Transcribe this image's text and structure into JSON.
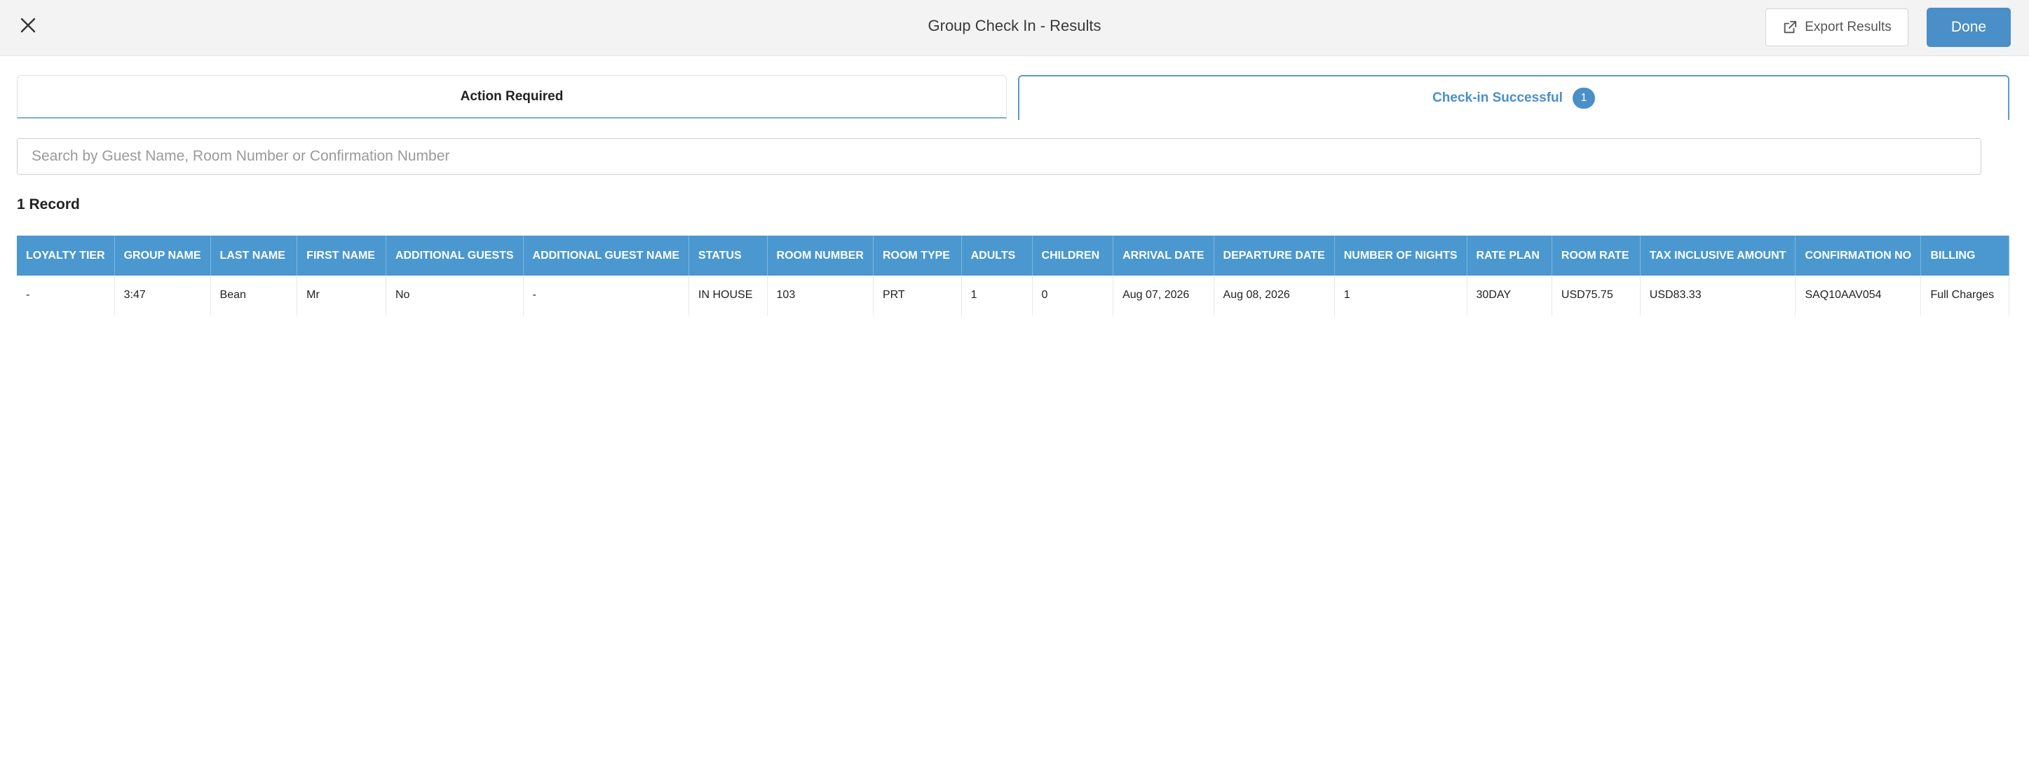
{
  "header": {
    "title": "Group Check In - Results",
    "export_label": "Export Results",
    "done_label": "Done"
  },
  "tabs": [
    {
      "label": "Action Required"
    },
    {
      "label": "Check-in Successful",
      "badge": "1"
    }
  ],
  "search": {
    "placeholder": "Search by Guest Name, Room Number or Confirmation Number",
    "value": ""
  },
  "record_count": "1 Record",
  "table": {
    "columns": [
      "LOYALTY TIER",
      "GROUP NAME",
      "LAST NAME",
      "FIRST NAME",
      "ADDITIONAL GUESTS",
      "ADDITIONAL GUEST NAME",
      "STATUS",
      "ROOM NUMBER",
      "ROOM TYPE",
      "ADULTS",
      "CHILDREN",
      "ARRIVAL DATE",
      "DEPARTURE DATE",
      "NUMBER OF NIGHTS",
      "RATE PLAN",
      "ROOM RATE",
      "TAX INCLUSIVE AMOUNT",
      "CONFIRMATION NO",
      "BILLING"
    ],
    "rows": [
      [
        "-",
        "3:47",
        "Bean",
        "Mr",
        "No",
        "-",
        "IN HOUSE",
        "103",
        "PRT",
        "1",
        "0",
        "Aug 07, 2026",
        "Aug 08, 2026",
        "1",
        "30DAY",
        "USD75.75",
        "USD83.33",
        "SAQ10AAV054",
        "Full Charges"
      ]
    ]
  },
  "colors": {
    "accent": "#4a8fc8",
    "table_header": "#4a98cf",
    "header_bg": "#f3f3f3"
  },
  "icons": {
    "close": "close-icon",
    "export": "external-link-icon"
  }
}
